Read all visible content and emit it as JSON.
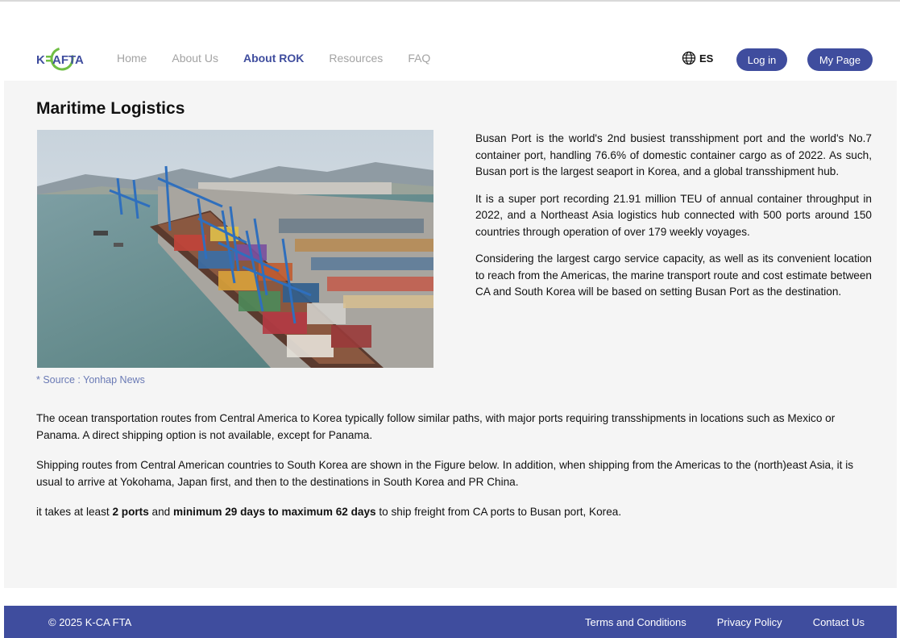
{
  "header": {
    "logo_text": "K-CAFTA",
    "nav": [
      "Home",
      "About Us",
      "About ROK",
      "Resources",
      "FAQ"
    ],
    "active_nav": "About ROK",
    "language": "ES",
    "login_label": "Log in",
    "mypage_label": "My Page"
  },
  "main": {
    "title": "Maritime Logistics",
    "image_alt": "Busan container port aerial view",
    "caption": "* Source : Yonhap News",
    "description": [
      "Busan Port is the world's 2nd busiest transshipment port and the world's No.7 container port, handling 76.6% of domestic container cargo as of 2022. As such, Busan port is the largest seaport in Korea, and a global transshipment hub.",
      "It is a super port recording 21.91 million TEU of annual container throughput in 2022, and a Northeast Asia logistics hub connected with 500 ports around 150 countries through operation of over 179 weekly voyages.",
      "Considering the largest cargo service capacity, as well as its convenient location to reach from the Americas, the marine transport route and cost estimate between CA and South Korea will be based on setting Busan Port as the destination."
    ],
    "paragraph1": "The ocean transportation routes from Central America to Korea typically follow similar paths, with major ports requiring transshipments in locations such as Mexico or Panama. A direct shipping option is not available, except for Panama.",
    "paragraph2": "Shipping routes from Central American countries to South Korea are shown in the Figure below. In addition, when shipping from the Americas to the (north)east Asia, it is usual to arrive at Yokohama, Japan first, and then to the destinations in South Korea and PR China.",
    "paragraph3": {
      "pre": "it takes at least ",
      "bold1": "2 ports",
      "mid": " and ",
      "bold2": "minimum 29 days to maximum 62 days",
      "post": " to ship freight from CA ports to Busan port, Korea."
    }
  },
  "footer": {
    "copyright": "© 2025 K-CA FTA",
    "links": [
      "Terms and Conditions",
      "Privacy Policy",
      "Contact Us"
    ]
  },
  "colors": {
    "brand": "#3f4d9e",
    "logo_green": "#6fbe44",
    "background_gray": "#f5f5f5"
  }
}
